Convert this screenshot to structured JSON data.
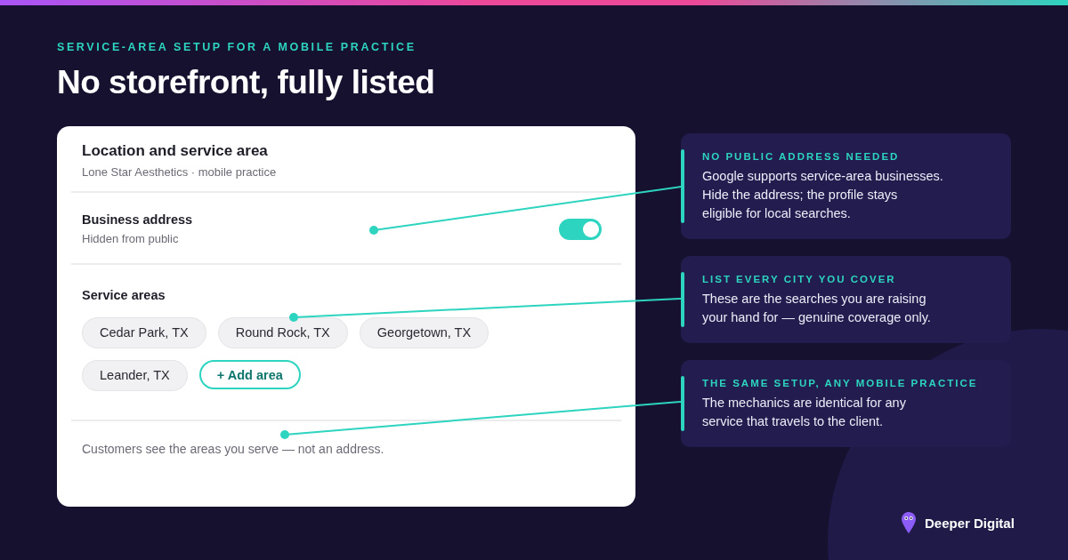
{
  "eyebrow": "SERVICE-AREA SETUP FOR A MOBILE PRACTICE",
  "title": "No storefront, fully listed",
  "card": {
    "title": "Location and service area",
    "subtitle": "Lone Star Aesthetics · mobile practice",
    "address": {
      "label": "Business address",
      "hint": "Hidden from public",
      "on": true
    },
    "service_areas": {
      "label": "Service areas",
      "chips": [
        {
          "label": "Cedar Park, TX"
        },
        {
          "label": "Round Rock, TX"
        },
        {
          "label": "Georgetown, TX"
        },
        {
          "label": "Leander, TX"
        }
      ],
      "add_button": "+ Add area"
    },
    "footer": "Customers see the areas you serve — not an address."
  },
  "callouts": [
    {
      "heading": "NO PUBLIC ADDRESS NEEDED",
      "body": "Google supports service-area businesses.\nHide the address; the profile stays\neligible for local searches."
    },
    {
      "heading": "LIST EVERY CITY YOU COVER",
      "body": "These are the searches you are raising\nyour hand for — genuine coverage only."
    },
    {
      "heading": "THE SAME SETUP, ANY MOBILE PRACTICE",
      "body": "The mechanics are identical for any\nservice that travels to the client."
    }
  ],
  "brand": "Deeper Digital"
}
